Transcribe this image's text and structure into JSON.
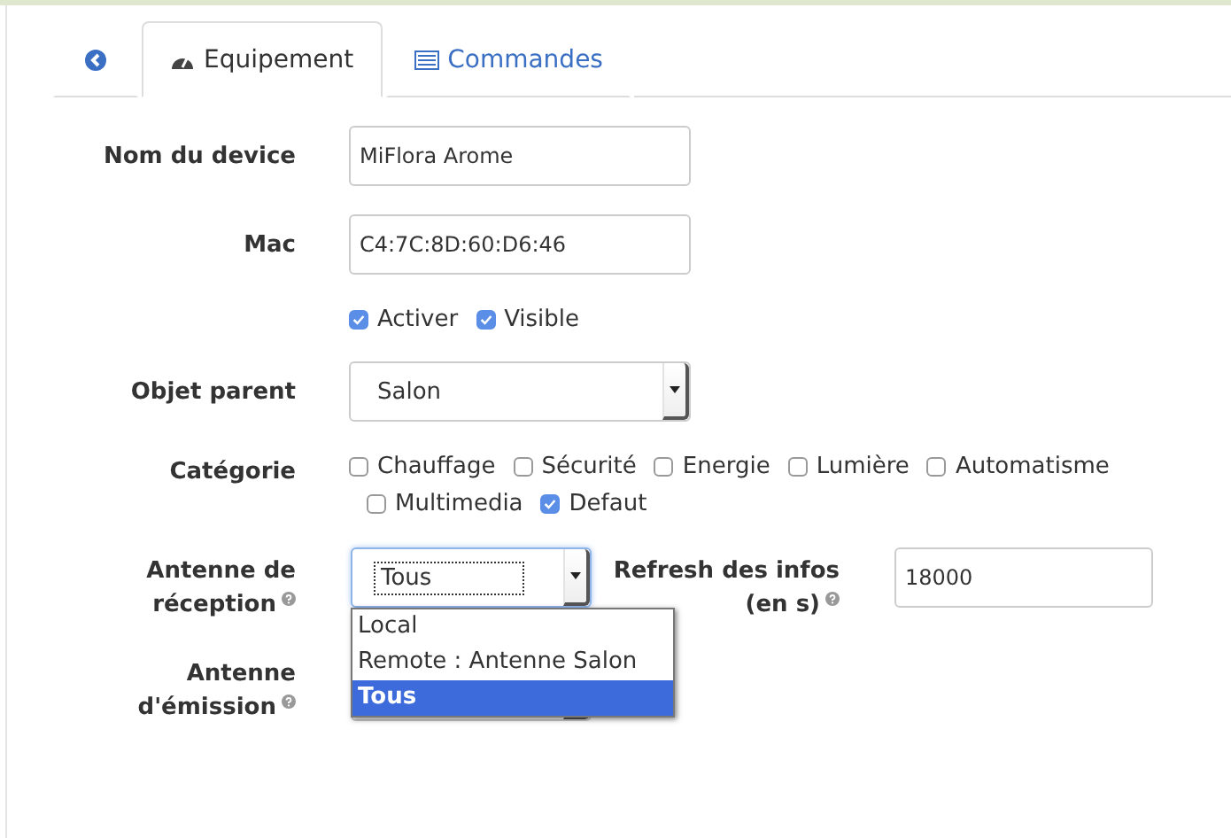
{
  "tabs": [
    {
      "kind": "back",
      "selected": false
    },
    {
      "kind": "gauge",
      "label": "Equipement",
      "selected": true
    },
    {
      "kind": "list",
      "label": "Commandes",
      "selected": false
    }
  ],
  "name_field": {
    "label": "Nom du device",
    "value": "MiFlora Arome"
  },
  "mac_field": {
    "label": "Mac",
    "value": "C4:7C:8D:60:D6:46"
  },
  "flags": [
    {
      "label": "Activer",
      "checked": true
    },
    {
      "label": "Visible",
      "checked": true
    }
  ],
  "parent_select": {
    "label": "Objet parent",
    "value": "Salon"
  },
  "categories": {
    "label": "Catégorie",
    "items": [
      {
        "label": "Chauffage",
        "checked": false
      },
      {
        "label": "Sécurité",
        "checked": false
      },
      {
        "label": "Energie",
        "checked": false
      },
      {
        "label": "Lumière",
        "checked": false
      },
      {
        "label": "Automatisme",
        "checked": false
      },
      {
        "label": "Multimedia",
        "checked": false
      },
      {
        "label": "Defaut",
        "checked": true
      }
    ]
  },
  "reception_select": {
    "label_line1": "Antenne de",
    "label_line2": "réception",
    "value": "Tous",
    "expanded": true,
    "options": [
      {
        "label": "Local",
        "selected": false
      },
      {
        "label": "Remote : Antenne Salon",
        "selected": false
      },
      {
        "label": "Tous",
        "selected": true
      }
    ]
  },
  "refresh_field": {
    "label_line1": "Refresh des infos",
    "label_line2": "(en s)",
    "value": "18000"
  },
  "emission_select": {
    "label_line1": "Antenne",
    "label_line2": "d'émission"
  }
}
